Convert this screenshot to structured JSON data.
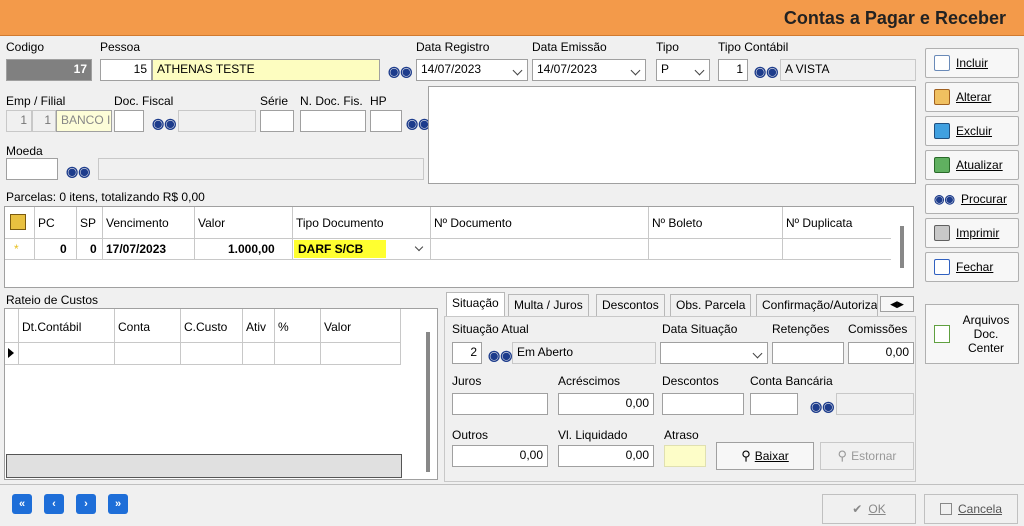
{
  "window": {
    "title": "Contas a Pagar e Receber"
  },
  "header": {
    "codigo_label": "Codigo",
    "codigo_value": "17",
    "pessoa_label": "Pessoa",
    "pessoa_id": "15",
    "pessoa_nome": "ATHENAS TESTE",
    "data_registro_label": "Data Registro",
    "data_registro": "14/07/2023",
    "data_emissao_label": "Data Emissão",
    "data_emissao": "14/07/2023",
    "tipo_label": "Tipo",
    "tipo": "P",
    "tipo_contabil_label": "Tipo Contábil",
    "tipo_contabil_id": "1",
    "tipo_contabil_nome": "A VISTA",
    "emp_label": "Emp / Filial",
    "emp": "1",
    "filial": "1",
    "filial_nome": "BANCO I",
    "doc_fiscal_label": "Doc. Fiscal",
    "serie_label": "Série",
    "n_doc_label": "N. Doc. Fis.",
    "hp_label": "HP",
    "moeda_label": "Moeda"
  },
  "parcelas": {
    "summary": "Parcelas: 0 itens, totalizando R$ 0,00",
    "columns": [
      "PC",
      "SP",
      "Vencimento",
      "Valor",
      "Tipo Documento",
      "Nº Documento",
      "Nº Boleto",
      "Nº Duplicata"
    ],
    "row": {
      "pc": "0",
      "sp": "0",
      "vencimento": "17/07/2023",
      "valor": "1.000,00",
      "tipo_doc": "DARF S/CB"
    }
  },
  "rateio": {
    "title": "Rateio de Custos",
    "columns": [
      "Dt.Contábil",
      "Conta",
      "C.Custo",
      "Ativ",
      "%",
      "Valor"
    ]
  },
  "tabs": [
    "Situação",
    "Multa / Juros",
    "Descontos",
    "Obs. Parcela",
    "Confirmação/Autoriza"
  ],
  "situacao": {
    "situacao_atual_label": "Situação Atual",
    "situacao_id": "2",
    "situacao_nome": "Em Aberto",
    "data_situacao_label": "Data Situação",
    "retencoes_label": "Retenções",
    "comissoes_label": "Comissões",
    "comissoes": "0,00",
    "juros_label": "Juros",
    "acrescimos_label": "Acréscimos",
    "acrescimos": "0,00",
    "descontos_label": "Descontos",
    "conta_bancaria_label": "Conta Bancária",
    "outros_label": "Outros",
    "outros": "0,00",
    "vl_liquidado_label": "Vl. Liquidado",
    "vl_liquidado": "0,00",
    "atraso_label": "Atraso",
    "baixar_label": "Baixar",
    "estornar_label": "Estornar"
  },
  "side": {
    "incluir": "Incluir",
    "alterar": "Alterar",
    "excluir": "Excluir",
    "atualizar": "Atualizar",
    "procurar": "Procurar",
    "imprimir": "Imprimir",
    "fechar": "Fechar",
    "arquivos": "Arquivos Doc. Center"
  },
  "footer": {
    "ok": "OK",
    "cancela": "Cancela"
  }
}
